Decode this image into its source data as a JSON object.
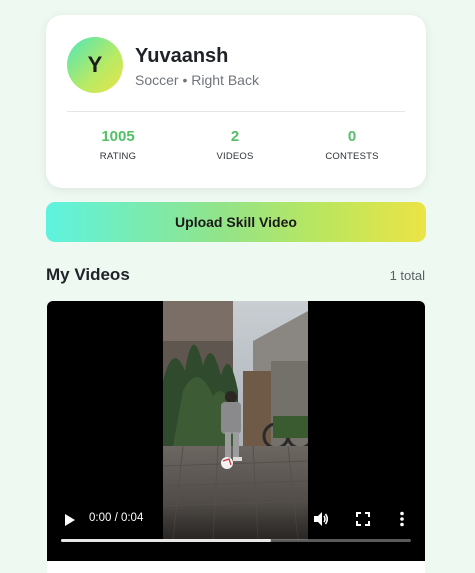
{
  "profile": {
    "avatar_initial": "Y",
    "name": "Yuvaansh",
    "subtitle": "Soccer • Right Back",
    "stats": [
      {
        "value": "1005",
        "label": "RATING"
      },
      {
        "value": "2",
        "label": "VIDEOS"
      },
      {
        "value": "0",
        "label": "CONTESTS"
      }
    ]
  },
  "upload_button_label": "Upload Skill Video",
  "videos_section": {
    "title": "My Videos",
    "count_label": "1 total"
  },
  "video_player": {
    "time_display": "0:00 / 0:04",
    "buffered_fraction": 0.6
  },
  "colors": {
    "accent_green": "#53c066",
    "background": "#eef9f1"
  }
}
